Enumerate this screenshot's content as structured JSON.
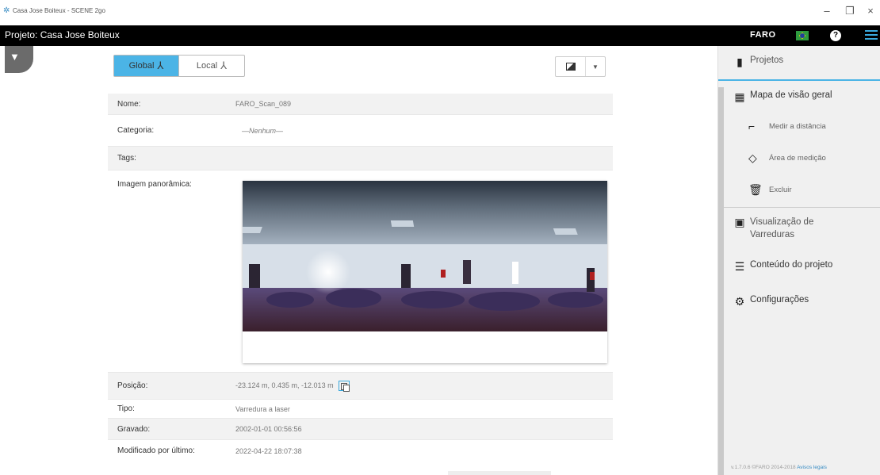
{
  "window": {
    "title": "Casa Jose Boiteux - SCENE 2go",
    "controls": {
      "minimize": "–",
      "restore": "❐",
      "close": "×"
    }
  },
  "topbar": {
    "project_title": "Projeto: Casa Jose Boiteux",
    "brand": "FARO",
    "help": "?"
  },
  "main": {
    "segmented": [
      {
        "label": "Global",
        "active": true
      },
      {
        "label": "Local",
        "active": false
      }
    ],
    "fields": {
      "name_label": "Nome:",
      "name_value": "FARO_Scan_089",
      "category_label": "Categoria:",
      "category_value": "—Nenhum—",
      "tags_label": "Tags:",
      "tags_value": "",
      "pano_label": "Imagem panorâmica:",
      "position_label": "Posição:",
      "position_value": "-23.124 m, 0.435 m, -12.013 m",
      "type_label": "Tipo:",
      "type_value": "Varredura a laser",
      "recorded_label": "Gravado:",
      "recorded_value": "2002-01-01 00:56:56",
      "modified_label": "Modificado por último:",
      "modified_value": "2022-04-22 18:07:38"
    }
  },
  "sidebar": {
    "projects": "Projetos",
    "overview_map": "Mapa de visão geral",
    "measure_distance": "Medir a distância",
    "measure_area": "Área de medição",
    "delete": "Excluir",
    "scan_view_line1": "Visualização de",
    "scan_view_line2": "Varreduras",
    "project_content": "Conteúdo do projeto",
    "settings": "Configurações",
    "footer_version": "v.1.7.0.6  ©FARO 2014-2018",
    "footer_link": "Avisos legais"
  },
  "colors": {
    "accent": "#4bb4e6",
    "topbar": "#000000",
    "sidebar_bg": "#f0f0f0"
  }
}
